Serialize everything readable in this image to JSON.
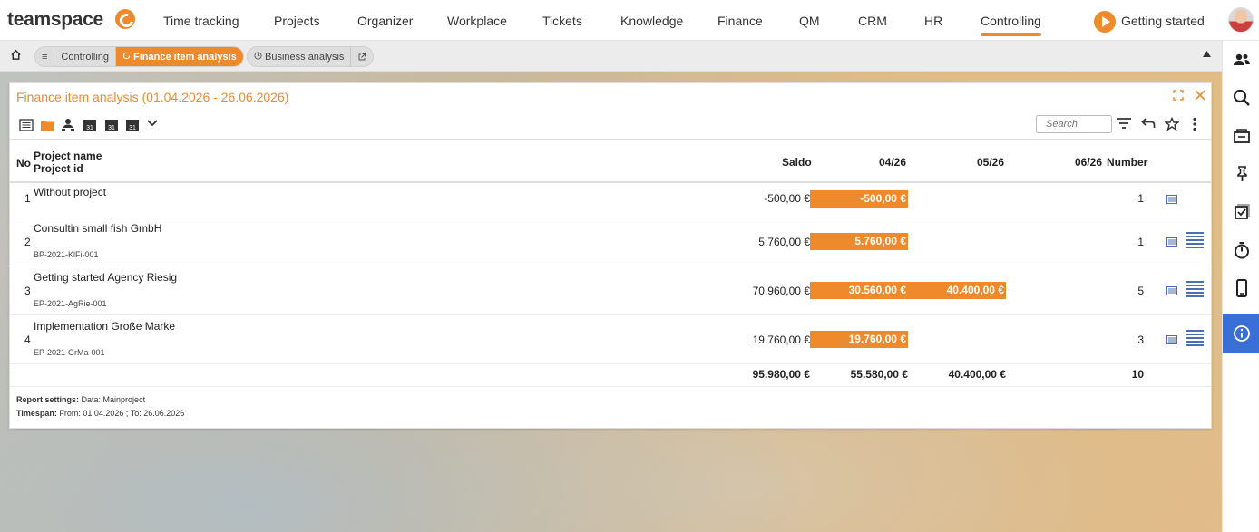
{
  "app": {
    "logo": "teamspace"
  },
  "nav": {
    "items": [
      "Time tracking",
      "Projects",
      "Organizer",
      "Workplace",
      "Tickets",
      "Knowledge",
      "Finance",
      "QM",
      "CRM",
      "HR",
      "Controlling"
    ],
    "active": "Controlling",
    "getting_started": "Getting started"
  },
  "breadcrumb": {
    "menu_glyph": "≡",
    "controlling": "Controlling",
    "finance_item_analysis": "Finance item analysis",
    "business_analysis": "Business analysis"
  },
  "panel": {
    "title": "Finance item analysis (01.04.2026 - 26.06.2026)",
    "search_placeholder": "Search"
  },
  "table": {
    "headers": {
      "no": "No",
      "project_name": "Project name",
      "project_id": "Project id",
      "saldo": "Saldo",
      "m1": "04/26",
      "m2": "05/26",
      "m3": "06/26",
      "number": "Number"
    },
    "rows": [
      {
        "no": "1",
        "name": "Without project",
        "id": "",
        "saldo": "-500,00 €",
        "m1": "-500,00 €",
        "m2": "",
        "number": "1"
      },
      {
        "no": "2",
        "name": "Consultin small fish GmbH",
        "id": "BP-2021-KlFi-001",
        "saldo": "5.760,00 €",
        "m1": "5.760,00 €",
        "m2": "",
        "number": "1"
      },
      {
        "no": "3",
        "name": "Getting started Agency Riesig",
        "id": "EP-2021-AgRie-001",
        "saldo": "70.960,00 €",
        "m1": "30.560,00 €",
        "m2": "40.400,00 €",
        "number": "5"
      },
      {
        "no": "4",
        "name": "Implementation Große Marke",
        "id": "EP-2021-GrMa-001",
        "saldo": "19.760,00 €",
        "m1": "19.760,00 €",
        "m2": "",
        "number": "3"
      }
    ],
    "totals": {
      "saldo": "95.980,00 €",
      "m1": "55.580,00 €",
      "m2": "40.400,00 €",
      "number": "10"
    }
  },
  "footer": {
    "report_label": "Report settings:",
    "report_value": "Data: Mainproject",
    "timespan_label": "Timespan:",
    "timespan_value": "From: 01.04.2026 ; To: 26.06.2026"
  },
  "colors": {
    "accent": "#ee8a2c",
    "sidebar_active": "#3a6fd8",
    "list_icon": "#4a6fb5"
  }
}
